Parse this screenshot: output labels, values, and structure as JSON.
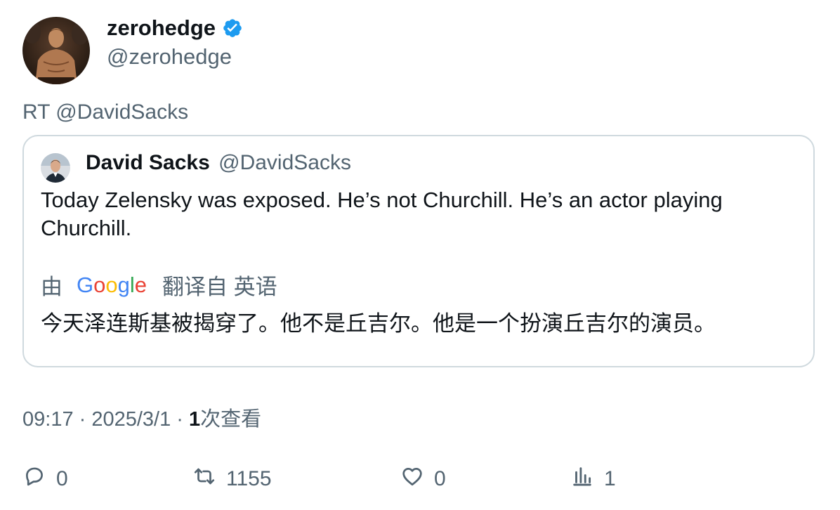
{
  "tweet": {
    "display_name": "zerohedge",
    "handle": "@zerohedge",
    "verified": true,
    "retweet_label": "RT @DavidSacks"
  },
  "quote": {
    "display_name": "David Sacks",
    "handle": "@DavidSacks",
    "text": "Today Zelensky was exposed. He’s not Churchill. He’s an actor playing Churchill.",
    "translate_prefix": "由",
    "translate_brand": "Google",
    "translate_suffix": "翻译自 英语",
    "translation": "今天泽连斯基被揭穿了。他不是丘吉尔。他是一个扮演丘吉尔的演员。"
  },
  "meta": {
    "time": "09:17",
    "date": "2025/3/1",
    "separator": " · ",
    "views_count": "1",
    "views_label": "次查看"
  },
  "actions": {
    "replies": "0",
    "retweets": "1155",
    "likes": "0",
    "views": "1"
  },
  "colors": {
    "text_primary": "#0f1419",
    "text_secondary": "#536471",
    "verified": "#1d9bf0",
    "border": "#cfd9de"
  },
  "icons": [
    "verified-badge-icon",
    "reply-icon",
    "retweet-icon",
    "like-icon",
    "views-icon"
  ]
}
